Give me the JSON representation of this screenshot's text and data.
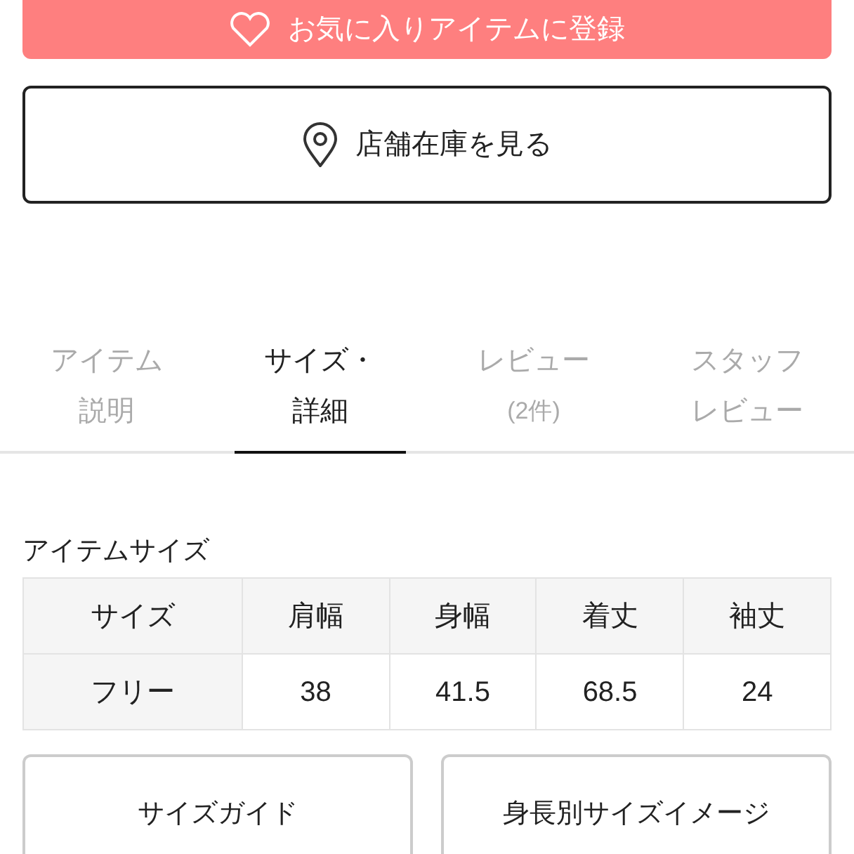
{
  "favorite_button": {
    "label": "お気に入りアイテムに登録"
  },
  "store_button": {
    "label": "店舗在庫を見る"
  },
  "tabs": [
    {
      "lines": [
        "アイテム",
        "説明"
      ],
      "selected": false
    },
    {
      "lines": [
        "サイズ・",
        "詳細"
      ],
      "selected": true
    },
    {
      "lines": [
        "レビュー",
        "(2件)"
      ],
      "selected": false
    },
    {
      "lines": [
        "スタッフ",
        "レビュー"
      ],
      "selected": false
    }
  ],
  "size_section": {
    "title": "アイテムサイズ",
    "columns": [
      "サイズ",
      "肩幅",
      "身幅",
      "着丈",
      "袖丈"
    ],
    "rows": [
      [
        "フリー",
        "38",
        "41.5",
        "68.5",
        "24"
      ]
    ]
  },
  "buttons": [
    "サイズガイド",
    "身長別サイズイメージ"
  ]
}
